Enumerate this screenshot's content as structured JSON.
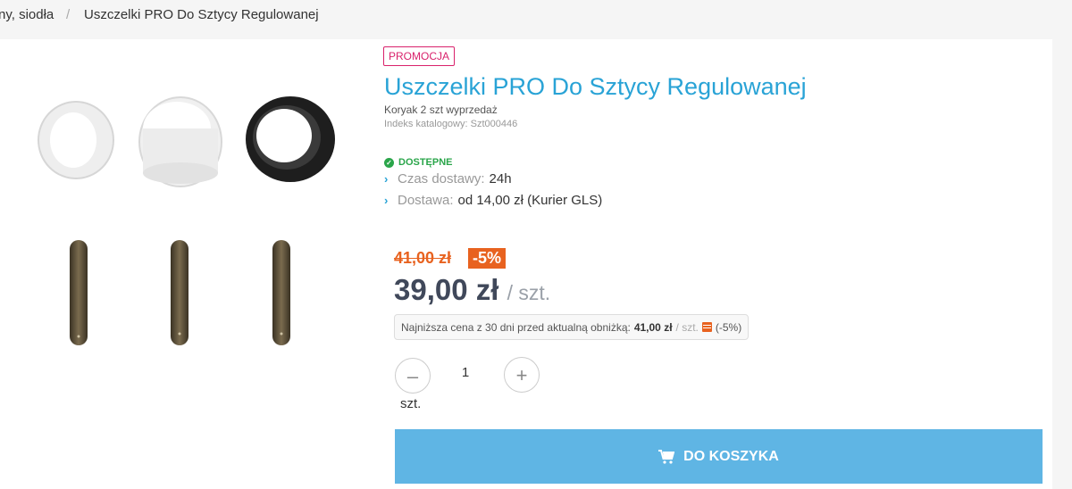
{
  "breadcrumb": {
    "items": [
      "ny, siodła",
      "Uszczelki PRO Do Sztycy Regulowanej"
    ],
    "separator": "/"
  },
  "product": {
    "badge": "PROMOCJA",
    "title": "Uszczelki PRO Do Sztycy Regulowanej",
    "subtitle": "Koryak 2 szt wyprzedaż",
    "catalog_index": "Indeks katalogowy: Szt000446",
    "availability": "DOSTĘPNE",
    "delivery_time_label": "Czas dostawy:",
    "delivery_time_value": "24h",
    "shipping_label": "Dostawa:",
    "shipping_value": "od 14,00 zł (Kurier GLS)"
  },
  "pricing": {
    "old_price": "41,00 zł",
    "discount": "-5%",
    "price": "39,00 zł",
    "unit": "/ szt.",
    "lowest_label": "Najniższa cena z 30 dni przed aktualną obniżką:",
    "lowest_value": "41,00 zł",
    "lowest_unit": "/ szt.",
    "lowest_diff": "(-5%)"
  },
  "quantity": {
    "minus": "–",
    "value": "1",
    "plus": "+",
    "unit": "szt."
  },
  "cart": {
    "label": "DO KOSZYKA"
  },
  "colors": {
    "accent": "#29a3d6",
    "promo": "#d9216b",
    "discount": "#e8621f",
    "available": "#2aa54a",
    "cart_button": "#5fb5e4"
  },
  "icons": [
    "check-icon",
    "chevron-right-icon",
    "calendar-icon",
    "cart-icon",
    "minus-icon",
    "plus-icon"
  ]
}
